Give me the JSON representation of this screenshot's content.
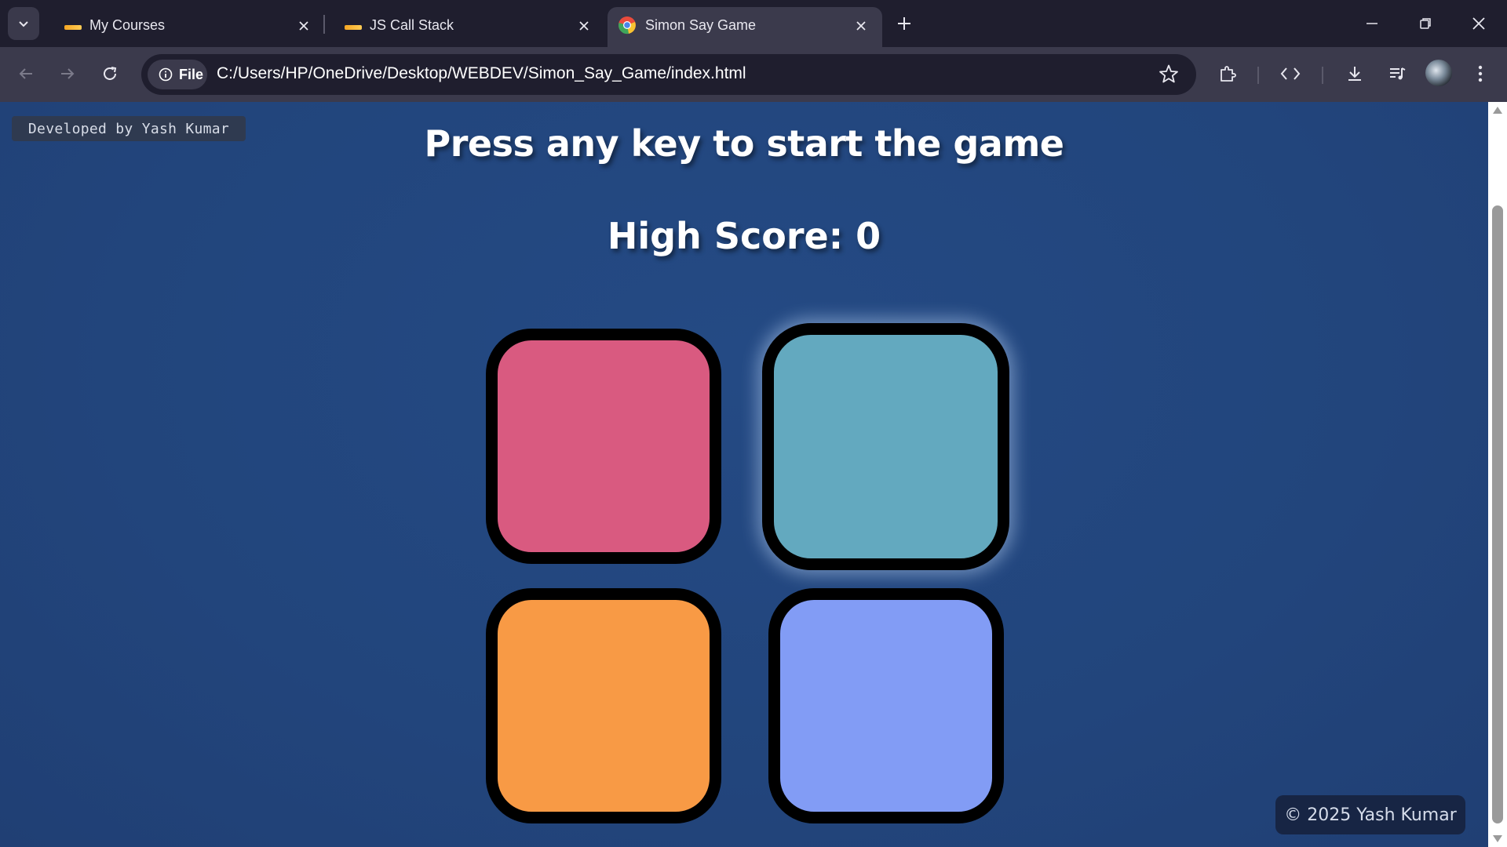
{
  "browser": {
    "tabs": [
      {
        "title": "My Courses",
        "active": false
      },
      {
        "title": "JS Call Stack",
        "active": false
      },
      {
        "title": "Simon Say Game",
        "active": true
      }
    ],
    "site_chip_label": "File",
    "url": "C:/Users/HP/OneDrive/Desktop/WEBDEV/Simon_Say_Game/index.html"
  },
  "page": {
    "developer_badge": "Developed by Yash Kumar",
    "headline": "Press any key to start the game",
    "high_score": "High Score: 0",
    "footer": "© 2025 Yash Kumar"
  },
  "game_buttons": [
    {
      "name": "red",
      "color": "#d95a80"
    },
    {
      "name": "cyan",
      "color": "#63a9bf"
    },
    {
      "name": "orange",
      "color": "#f89a45"
    },
    {
      "name": "blue",
      "color": "#829cf5"
    }
  ],
  "icons": {
    "tab_search": "chevron-down-icon",
    "close": "close-icon",
    "new_tab": "plus-icon",
    "minimize": "minimize-icon",
    "restore": "restore-icon",
    "window_close": "close-icon",
    "back": "back-arrow-icon",
    "forward": "forward-arrow-icon",
    "reload": "reload-icon",
    "info": "info-icon",
    "bookmark": "star-icon",
    "extensions": "puzzle-icon",
    "devtools": "code-icon",
    "downloads": "download-icon",
    "media": "media-control-icon",
    "profile": "avatar",
    "menu": "kebab-menu-icon"
  }
}
